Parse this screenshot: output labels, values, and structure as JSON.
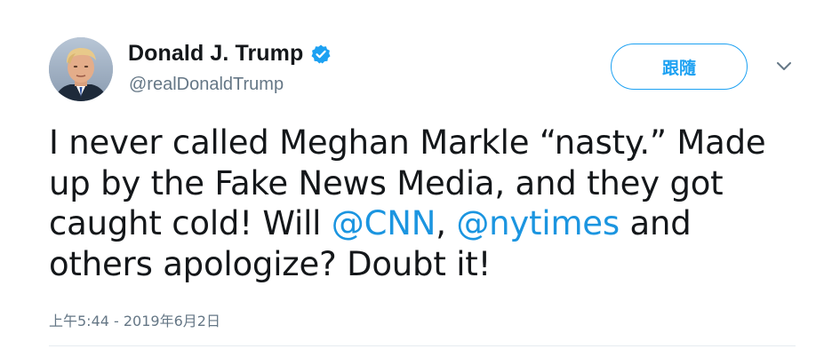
{
  "user": {
    "display_name": "Donald J. Trump",
    "handle": "@realDonaldTrump",
    "verified": true,
    "verified_icon": "verified-badge-icon",
    "avatar_icon": "profile-photo"
  },
  "follow_button": {
    "label": "跟隨"
  },
  "menu_icon": "chevron-down-icon",
  "tweet": {
    "text_part1": "I never called Meghan Markle “nasty.” Made up by the Fake News Media, and they got caught cold! Will ",
    "mention1": "@CNN",
    "text_part2": ", ",
    "mention2": "@nytimes",
    "text_part3": " and others apologize? Doubt it!"
  },
  "timestamp": "上午5:44 - 2019年6月2日",
  "colors": {
    "accent": "#1da1f2",
    "mention": "#1b95e0",
    "text": "#14171a",
    "secondary": "#657786",
    "divider": "#e6ecf0"
  }
}
